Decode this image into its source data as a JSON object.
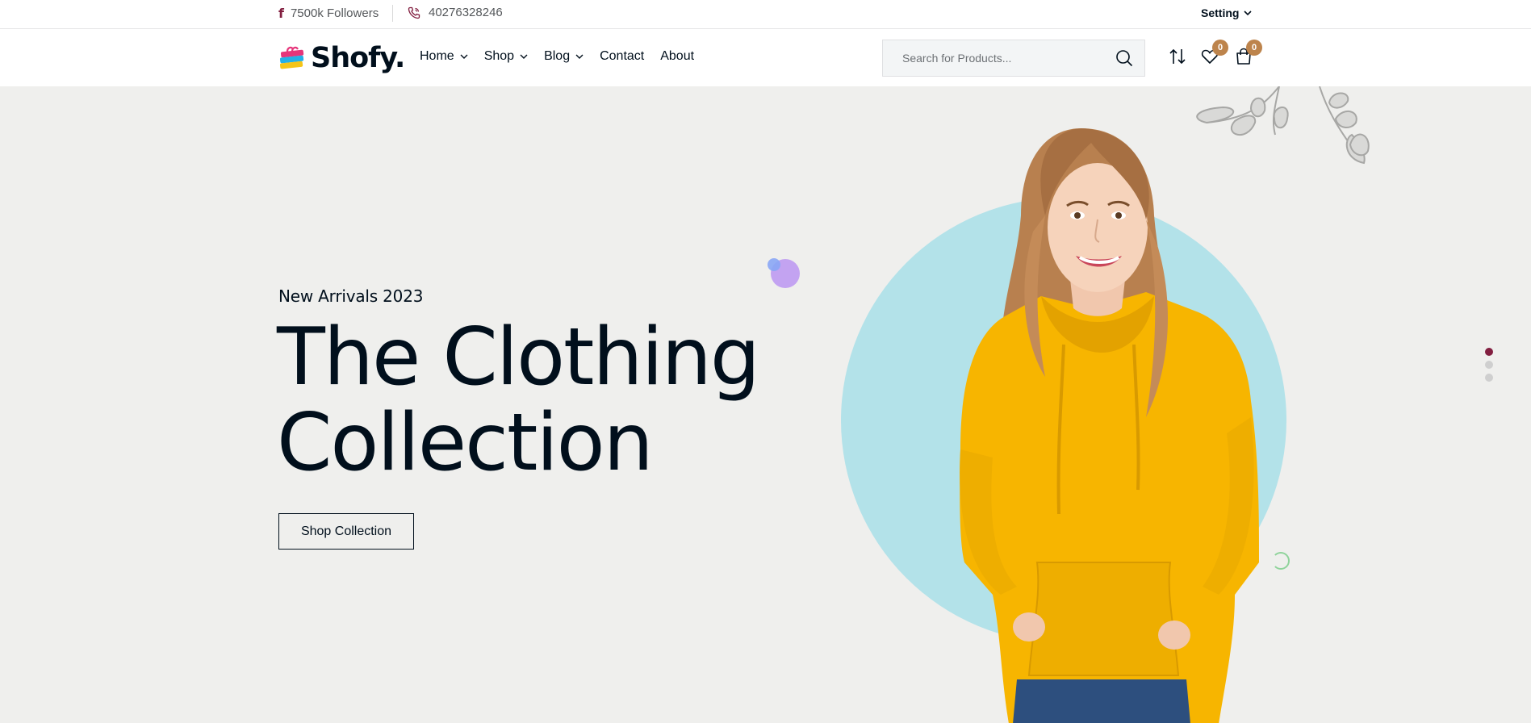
{
  "topbar": {
    "facebook_icon": "facebook-icon",
    "followers": "7500k Followers",
    "phone_icon": "phone-icon",
    "phone": "40276328246",
    "setting_label": "Setting"
  },
  "header": {
    "brand": "Shofy.",
    "nav": [
      {
        "label": "Home",
        "has_dropdown": true
      },
      {
        "label": "Shop",
        "has_dropdown": true
      },
      {
        "label": "Blog",
        "has_dropdown": true
      },
      {
        "label": "Contact",
        "has_dropdown": false
      },
      {
        "label": "About",
        "has_dropdown": false
      }
    ],
    "search": {
      "placeholder": "Search for Products...",
      "value": ""
    },
    "compare_icon": "sort-arrows-icon",
    "wishlist_count": "0",
    "cart_count": "0"
  },
  "hero": {
    "subtitle": "New Arrivals 2023",
    "title_line1": "The Clothing",
    "title_line2": "Collection",
    "button_label": "Shop Collection",
    "slides": 3,
    "active_slide": 1
  },
  "colors": {
    "accent": "#821f40",
    "badge": "#bd844c",
    "hero_bg": "#efefed",
    "circle": "#b3e2e9",
    "hoodie": "#f7b500",
    "text": "#010f1c"
  }
}
